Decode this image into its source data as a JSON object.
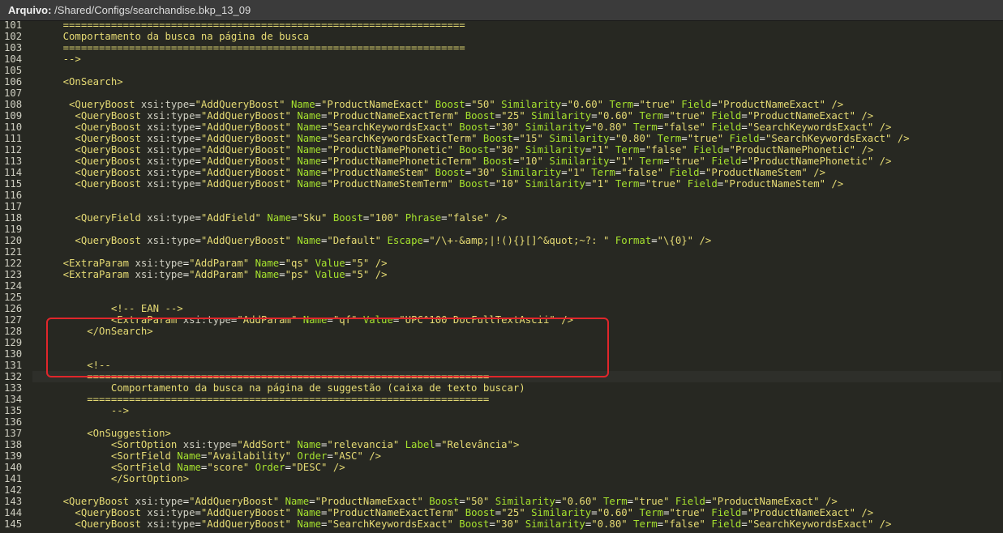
{
  "title_bar": {
    "label": "Arquivo:",
    "path": "/Shared/Configs/searchandise.bkp_13_09"
  },
  "editor": {
    "active_line": "132",
    "lines": [
      {
        "n": "101",
        "t": "    ==================================================================="
      },
      {
        "n": "102",
        "t": "    Comportamento da busca na página de busca"
      },
      {
        "n": "103",
        "t": "    ==================================================================="
      },
      {
        "n": "104",
        "t": "    -->"
      },
      {
        "n": "105",
        "t": ""
      },
      {
        "n": "106",
        "t": "    <OnSearch>"
      },
      {
        "n": "107",
        "t": ""
      },
      {
        "n": "108",
        "t": "     <QueryBoost xsi:type=\"AddQueryBoost\" Name=\"ProductNameExact\" Boost=\"50\" Similarity=\"0.60\" Term=\"true\" Field=\"ProductNameExact\" />"
      },
      {
        "n": "109",
        "t": "      <QueryBoost xsi:type=\"AddQueryBoost\" Name=\"ProductNameExactTerm\" Boost=\"25\" Similarity=\"0.60\" Term=\"true\" Field=\"ProductNameExact\" />"
      },
      {
        "n": "110",
        "t": "      <QueryBoost xsi:type=\"AddQueryBoost\" Name=\"SearchKeywordsExact\" Boost=\"30\" Similarity=\"0.80\" Term=\"false\" Field=\"SearchKeywordsExact\" />"
      },
      {
        "n": "111",
        "t": "      <QueryBoost xsi:type=\"AddQueryBoost\" Name=\"SearchKeywordsExactTerm\" Boost=\"15\" Similarity=\"0.80\" Term=\"true\" Field=\"SearchKeywordsExact\" />"
      },
      {
        "n": "112",
        "t": "      <QueryBoost xsi:type=\"AddQueryBoost\" Name=\"ProductNamePhonetic\" Boost=\"30\" Similarity=\"1\" Term=\"false\" Field=\"ProductNamePhonetic\" />"
      },
      {
        "n": "113",
        "t": "      <QueryBoost xsi:type=\"AddQueryBoost\" Name=\"ProductNamePhoneticTerm\" Boost=\"10\" Similarity=\"1\" Term=\"true\" Field=\"ProductNamePhonetic\" />"
      },
      {
        "n": "114",
        "t": "      <QueryBoost xsi:type=\"AddQueryBoost\" Name=\"ProductNameStem\" Boost=\"30\" Similarity=\"1\" Term=\"false\" Field=\"ProductNameStem\" />"
      },
      {
        "n": "115",
        "t": "      <QueryBoost xsi:type=\"AddQueryBoost\" Name=\"ProductNameStemTerm\" Boost=\"10\" Similarity=\"1\" Term=\"true\" Field=\"ProductNameStem\" />"
      },
      {
        "n": "116",
        "t": ""
      },
      {
        "n": "117",
        "t": ""
      },
      {
        "n": "118",
        "t": "      <QueryField xsi:type=\"AddField\" Name=\"Sku\" Boost=\"100\" Phrase=\"false\" />"
      },
      {
        "n": "119",
        "t": ""
      },
      {
        "n": "120",
        "t": "      <QueryBoost xsi:type=\"AddQueryBoost\" Name=\"Default\" Escape=\"/\\+-&amp;|!(){}[]^&quot;~?: \" Format=\"\\{0}\" />"
      },
      {
        "n": "121",
        "t": ""
      },
      {
        "n": "122",
        "t": "    <ExtraParam xsi:type=\"AddParam\" Name=\"qs\" Value=\"5\" />"
      },
      {
        "n": "123",
        "t": "    <ExtraParam xsi:type=\"AddParam\" Name=\"ps\" Value=\"5\" />"
      },
      {
        "n": "124",
        "t": ""
      },
      {
        "n": "125",
        "t": ""
      },
      {
        "n": "126",
        "t": "            <!-- EAN -->"
      },
      {
        "n": "127",
        "t": "            <ExtraParam xsi:type=\"AddParam\" Name=\"qf\" Value=\"UPC^100 DocFullTextAscii\" />"
      },
      {
        "n": "128",
        "t": "        </OnSearch>"
      },
      {
        "n": "129",
        "t": ""
      },
      {
        "n": "130",
        "t": ""
      },
      {
        "n": "131",
        "t": "        <!--"
      },
      {
        "n": "132",
        "t": "        ==================================================================="
      },
      {
        "n": "133",
        "t": "            Comportamento da busca na página de suggestão (caixa de texto buscar)"
      },
      {
        "n": "134",
        "t": "        ==================================================================="
      },
      {
        "n": "135",
        "t": "            -->"
      },
      {
        "n": "136",
        "t": ""
      },
      {
        "n": "137",
        "t": "        <OnSuggestion>"
      },
      {
        "n": "138",
        "t": "            <SortOption xsi:type=\"AddSort\" Name=\"relevancia\" Label=\"Relevância\">"
      },
      {
        "n": "139",
        "t": "            <SortField Name=\"Availability\" Order=\"ASC\" />"
      },
      {
        "n": "140",
        "t": "            <SortField Name=\"score\" Order=\"DESC\" />"
      },
      {
        "n": "141",
        "t": "            </SortOption>"
      },
      {
        "n": "142",
        "t": ""
      },
      {
        "n": "143",
        "t": "    <QueryBoost xsi:type=\"AddQueryBoost\" Name=\"ProductNameExact\" Boost=\"50\" Similarity=\"0.60\" Term=\"true\" Field=\"ProductNameExact\" />"
      },
      {
        "n": "144",
        "t": "      <QueryBoost xsi:type=\"AddQueryBoost\" Name=\"ProductNameExactTerm\" Boost=\"25\" Similarity=\"0.60\" Term=\"true\" Field=\"ProductNameExact\" />"
      },
      {
        "n": "145",
        "t": "      <QueryBoost xsi:type=\"AddQueryBoost\" Name=\"SearchKeywordsExact\" Boost=\"30\" Similarity=\"0.80\" Term=\"false\" Field=\"SearchKeywordsExact\" />"
      }
    ]
  },
  "colors": {
    "background": "#272822",
    "line_number": "#cfcfc2",
    "tag": "#e6db74",
    "attribute": "#a6e22e",
    "string": "#e6db74",
    "highlight_box": "#e0262b"
  }
}
